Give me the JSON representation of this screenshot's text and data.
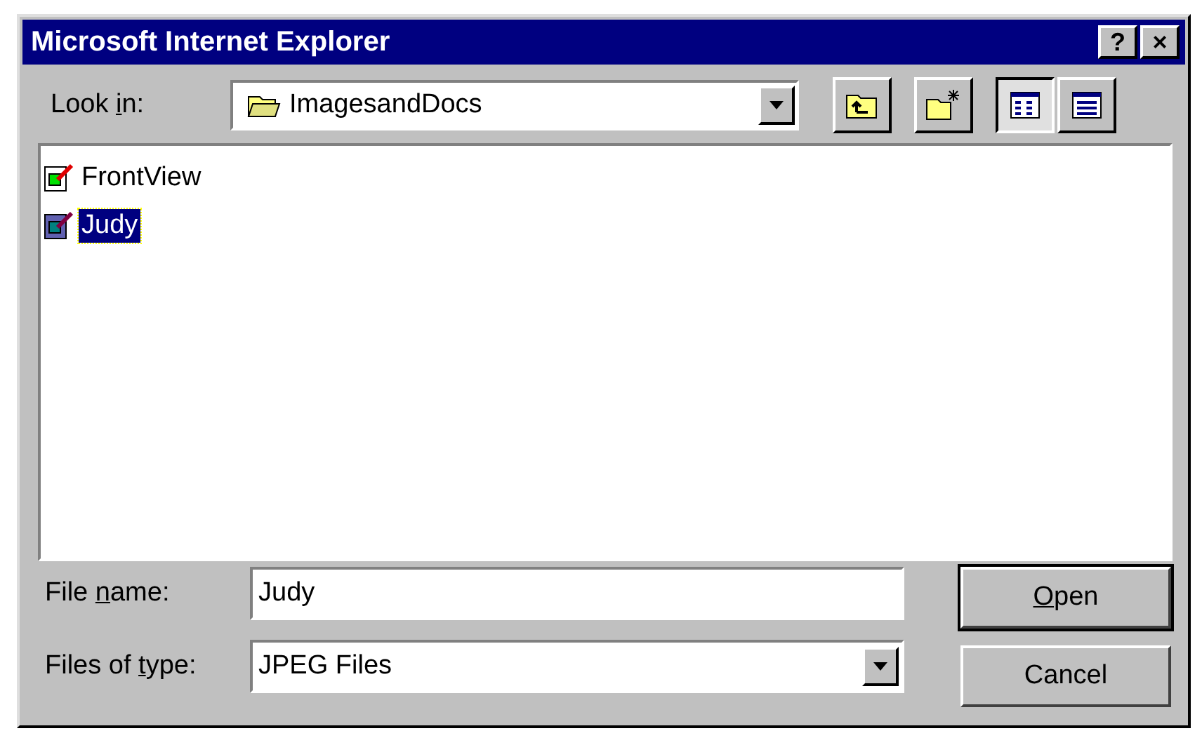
{
  "window": {
    "title": "Microsoft Internet Explorer",
    "title_buttons": [
      "?",
      "×"
    ]
  },
  "look_in": {
    "label_parts": {
      "before": "Look ",
      "key": "i",
      "after": "n:"
    },
    "value": "ImagesandDocs"
  },
  "toolbar": [
    {
      "kind": "up",
      "selected": false
    },
    {
      "kind": "new-folder",
      "selected": false
    },
    {
      "kind": "list",
      "selected": true
    },
    {
      "kind": "details",
      "selected": false
    }
  ],
  "files": [
    {
      "name": "FrontView",
      "selected": false
    },
    {
      "name": "Judy",
      "selected": true
    }
  ],
  "file_name": {
    "label_parts": {
      "before": "File ",
      "key": "n",
      "after": "ame:"
    },
    "value": "Judy"
  },
  "file_type": {
    "label_parts": {
      "before": "Files of ",
      "key": "t",
      "after": "ype:"
    },
    "value": "JPEG Files"
  },
  "buttons": [
    {
      "label_parts": {
        "key": "O",
        "after": "pen"
      },
      "default": true
    },
    {
      "label_parts": {
        "before": "Cancel"
      },
      "default": false
    }
  ]
}
